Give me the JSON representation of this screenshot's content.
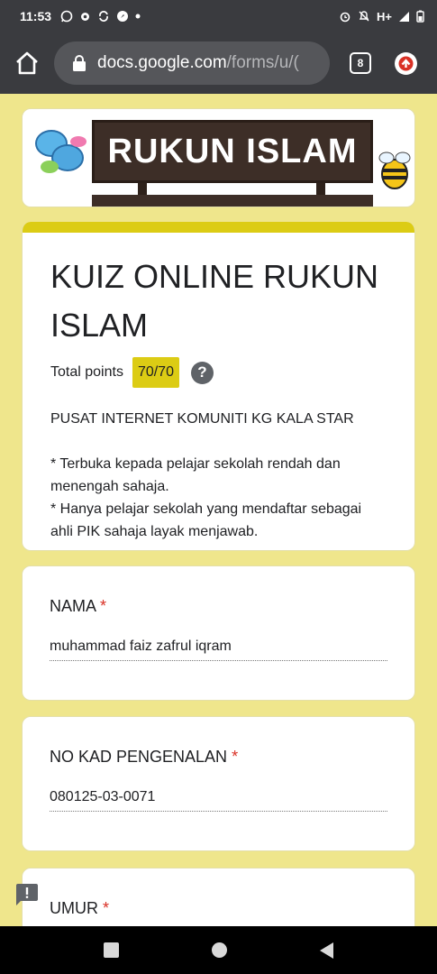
{
  "status_bar": {
    "time": "11:53",
    "network": "H+",
    "icons": [
      "whatsapp-icon",
      "settings-icon",
      "sync-icon",
      "compass-icon",
      "dot-icon",
      "alarm-icon",
      "mute-icon",
      "signal-icon",
      "battery-icon"
    ]
  },
  "browser": {
    "url_host": "docs.google.com",
    "url_path": "/forms/u/(",
    "tab_count": "8"
  },
  "banner": {
    "text": "RUKUN ISLAM"
  },
  "form": {
    "title": "KUIZ ONLINE RUKUN ISLAM",
    "points_label": "Total points",
    "points_value": "70/70",
    "help_symbol": "?",
    "org": "PUSAT INTERNET KOMUNITI KG KALA STAR",
    "notes": [
      "* Terbuka kepada pelajar sekolah rendah dan menengah sahaja.",
      "* Hanya pelajar sekolah yang mendaftar sebagai ahli PIK sahaja layak menjawab."
    ],
    "accent_color": "#dccc14",
    "background_color": "#efe68c"
  },
  "questions": [
    {
      "label": "NAMA",
      "required_mark": "*",
      "answer": "muhammad faiz zafrul iqram"
    },
    {
      "label": "NO KAD PENGENALAN",
      "required_mark": "*",
      "answer": "080125-03-0071"
    },
    {
      "label": "UMUR",
      "required_mark": "*",
      "answer": ""
    }
  ]
}
